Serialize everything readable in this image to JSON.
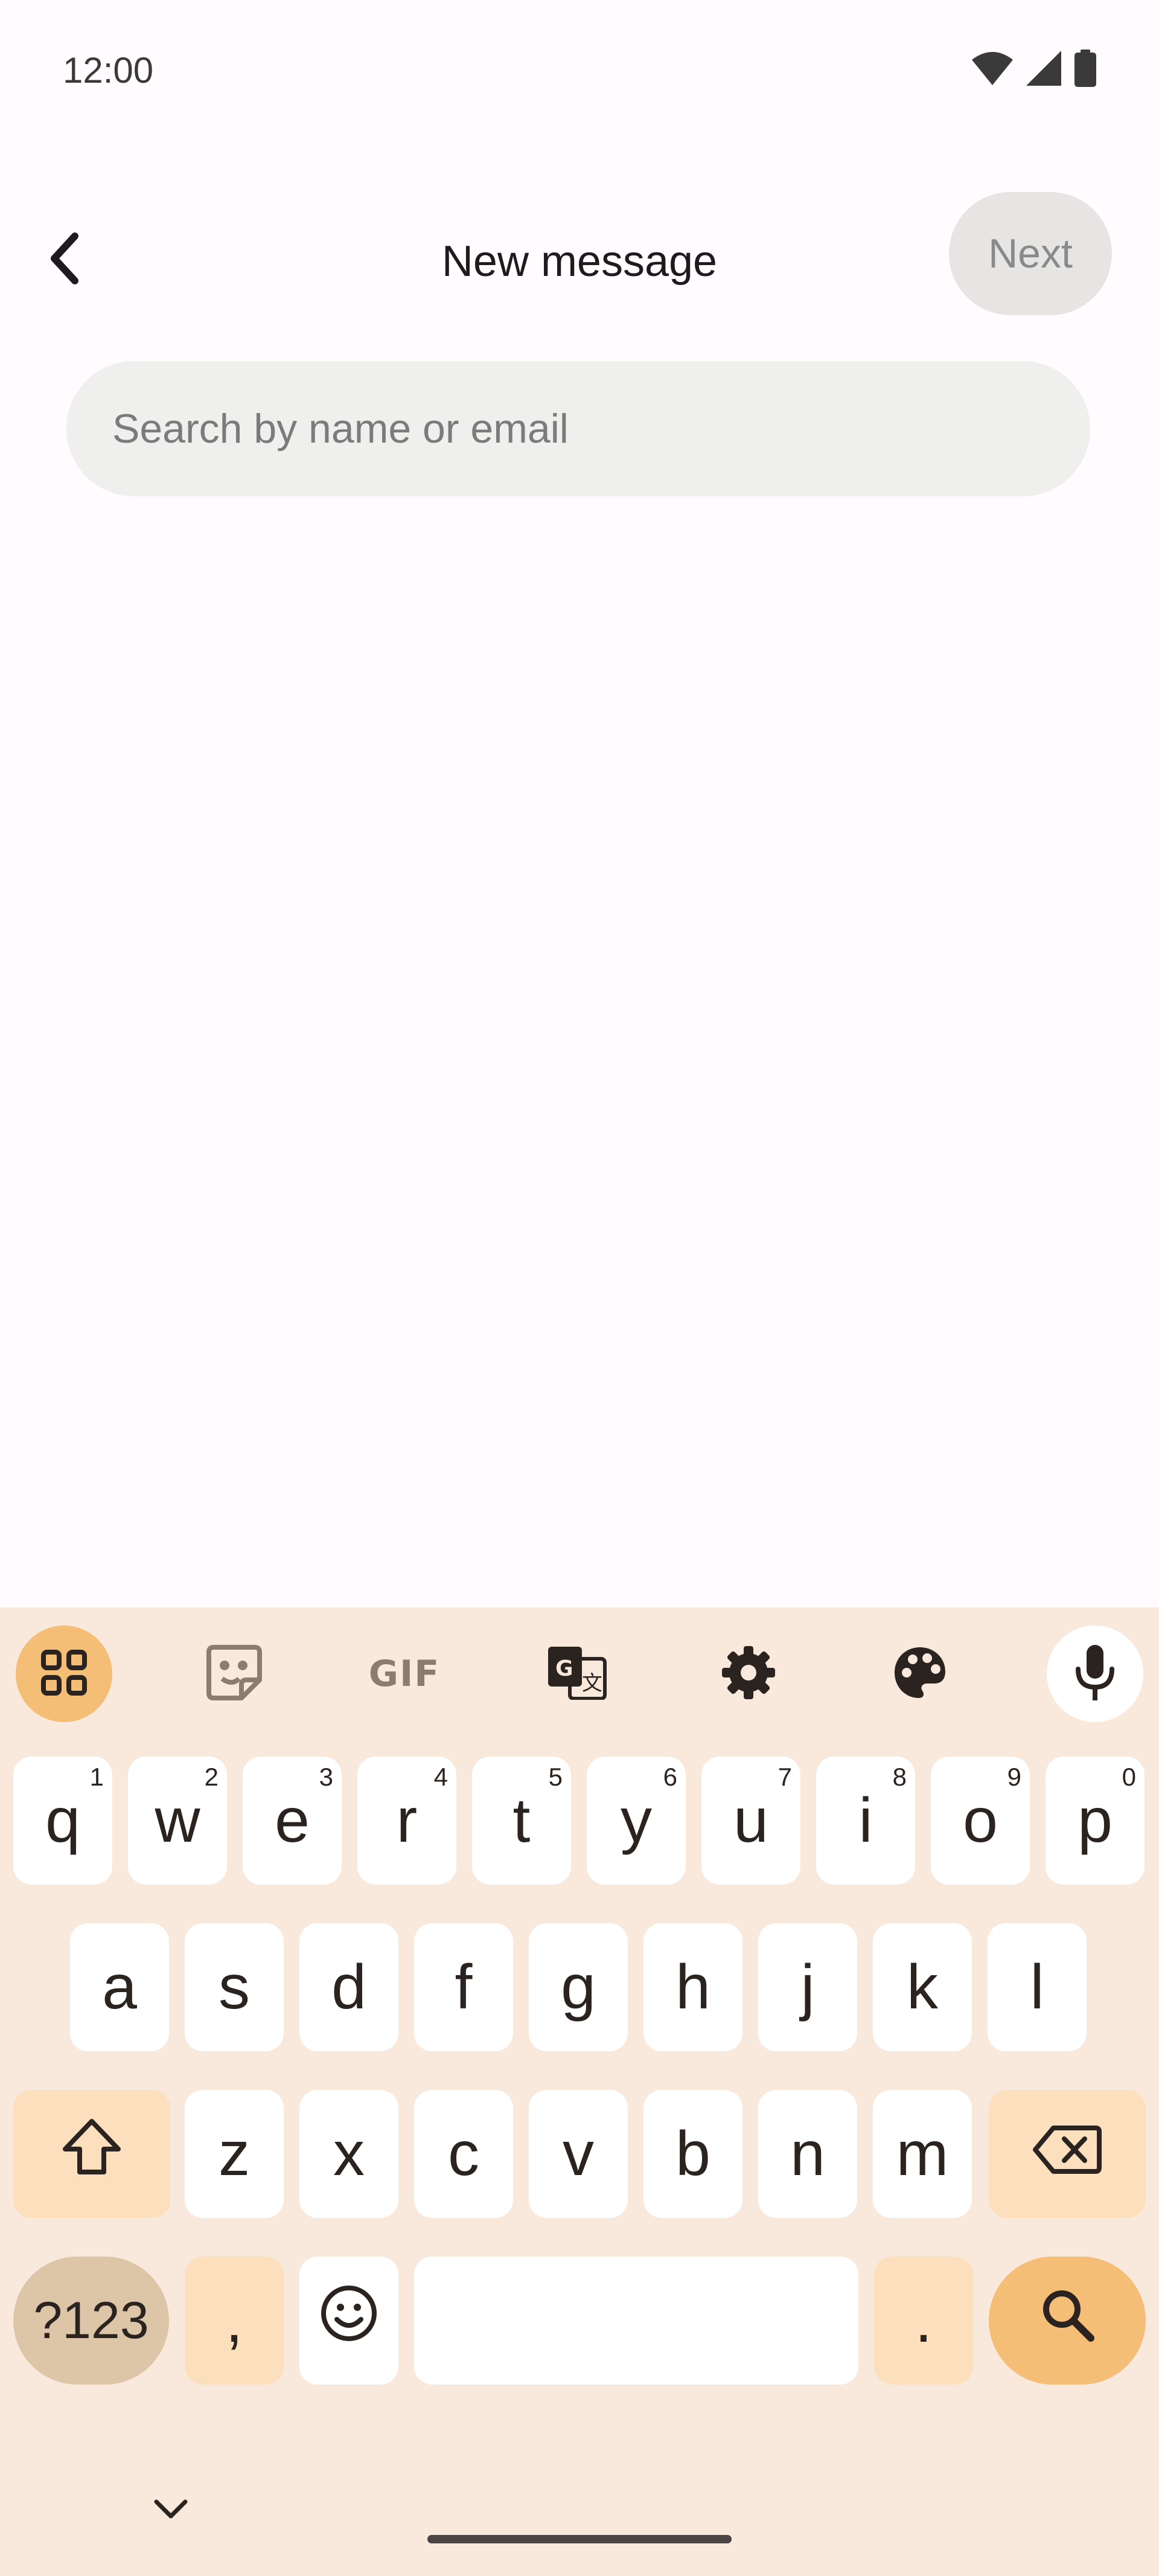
{
  "status_bar": {
    "time": "12:00",
    "icons": [
      "wifi-icon",
      "cellular-signal-icon",
      "battery-icon"
    ]
  },
  "app_bar": {
    "back_icon": "chevron-left-icon",
    "title": "New message",
    "next_label": "Next"
  },
  "search": {
    "value": "",
    "placeholder": "Search by name or email"
  },
  "keyboard": {
    "toolbar": {
      "apps_icon": "apps-grid-icon",
      "sticker_icon": "sticker-icon",
      "gif_label": "GIF",
      "translate_icon": "translate-icon",
      "settings_icon": "gear-icon",
      "theme_icon": "palette-icon",
      "mic_icon": "microphone-icon"
    },
    "row1": [
      {
        "char": "q",
        "hint": "1"
      },
      {
        "char": "w",
        "hint": "2"
      },
      {
        "char": "e",
        "hint": "3"
      },
      {
        "char": "r",
        "hint": "4"
      },
      {
        "char": "t",
        "hint": "5"
      },
      {
        "char": "y",
        "hint": "6"
      },
      {
        "char": "u",
        "hint": "7"
      },
      {
        "char": "i",
        "hint": "8"
      },
      {
        "char": "o",
        "hint": "9"
      },
      {
        "char": "p",
        "hint": "0"
      }
    ],
    "row2": [
      "a",
      "s",
      "d",
      "f",
      "g",
      "h",
      "j",
      "k",
      "l"
    ],
    "row3": [
      "z",
      "x",
      "c",
      "v",
      "b",
      "n",
      "m"
    ],
    "bottom": {
      "symbols_label": "?123",
      "comma": ",",
      "period": ".",
      "space_label": "",
      "emoji_icon": "emoji-icon",
      "action_icon": "search-icon",
      "shift_icon": "shift-icon",
      "backspace_icon": "backspace-icon",
      "collapse_icon": "chevron-down-icon"
    },
    "colors": {
      "background": "#F8E9DC",
      "modifier": "#FCE0BD",
      "symbols": "#DDC5A8",
      "accent": "#F4BE76"
    }
  }
}
